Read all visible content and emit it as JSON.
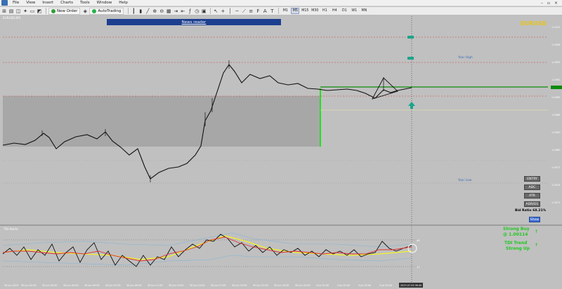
{
  "menu": [
    "File",
    "View",
    "Insert",
    "Charts",
    "Tools",
    "Window",
    "Help"
  ],
  "toolbar": {
    "new_order": "New Order",
    "auto_trading": "AutoTrading",
    "timeframes": [
      "M1",
      "M5",
      "M15",
      "M30",
      "H1",
      "H4",
      "D1",
      "W1",
      "MN"
    ],
    "active_timeframe": "M5"
  },
  "chart": {
    "title": "EURUSD,M5",
    "symbol": "EURUSD",
    "news_reader": "News reader",
    "indicator_title": "TDI Alerts",
    "levels": {
      "yearly_high": "Year High",
      "yearly_low": "Year Low"
    }
  },
  "side_panel": {
    "buttons": [
      "ENTRY",
      "ADC",
      "ATR",
      "ADR/D1"
    ],
    "bid_ratio": "Bid Ratio 68.21%",
    "show": "Show",
    "strong_buy": "Strong Buy",
    "strong_buy_price": "@ 1.00114",
    "tdi_trend": "TDI Trend",
    "tdi_trend_value": "Strong Up"
  },
  "colors": {
    "background": "#c0c0c0",
    "bull_candle": "#ffffff",
    "bear_candle": "#000000",
    "red_line": "#e03030",
    "green_line": "#1ec81e",
    "yellow_line": "#ffff00",
    "accent_teal": "#1aa58a",
    "symbol_gold": "#e5c21a"
  },
  "icons": [
    "new-chart-icon",
    "profiles-icon",
    "market-watch-icon",
    "navigator-icon",
    "terminal-icon",
    "strategy-tester-icon",
    "zoom-in-icon",
    "zoom-out-icon",
    "tile-icon",
    "autoscroll-icon",
    "chart-shift-icon",
    "indicators-icon",
    "periods-icon",
    "templates-icon",
    "cursor-icon",
    "crosshair-icon",
    "vertical-line-icon",
    "horizontal-line-icon",
    "trendline-icon",
    "channel-icon",
    "fibonacci-icon",
    "text-icon",
    "label-icon"
  ]
}
